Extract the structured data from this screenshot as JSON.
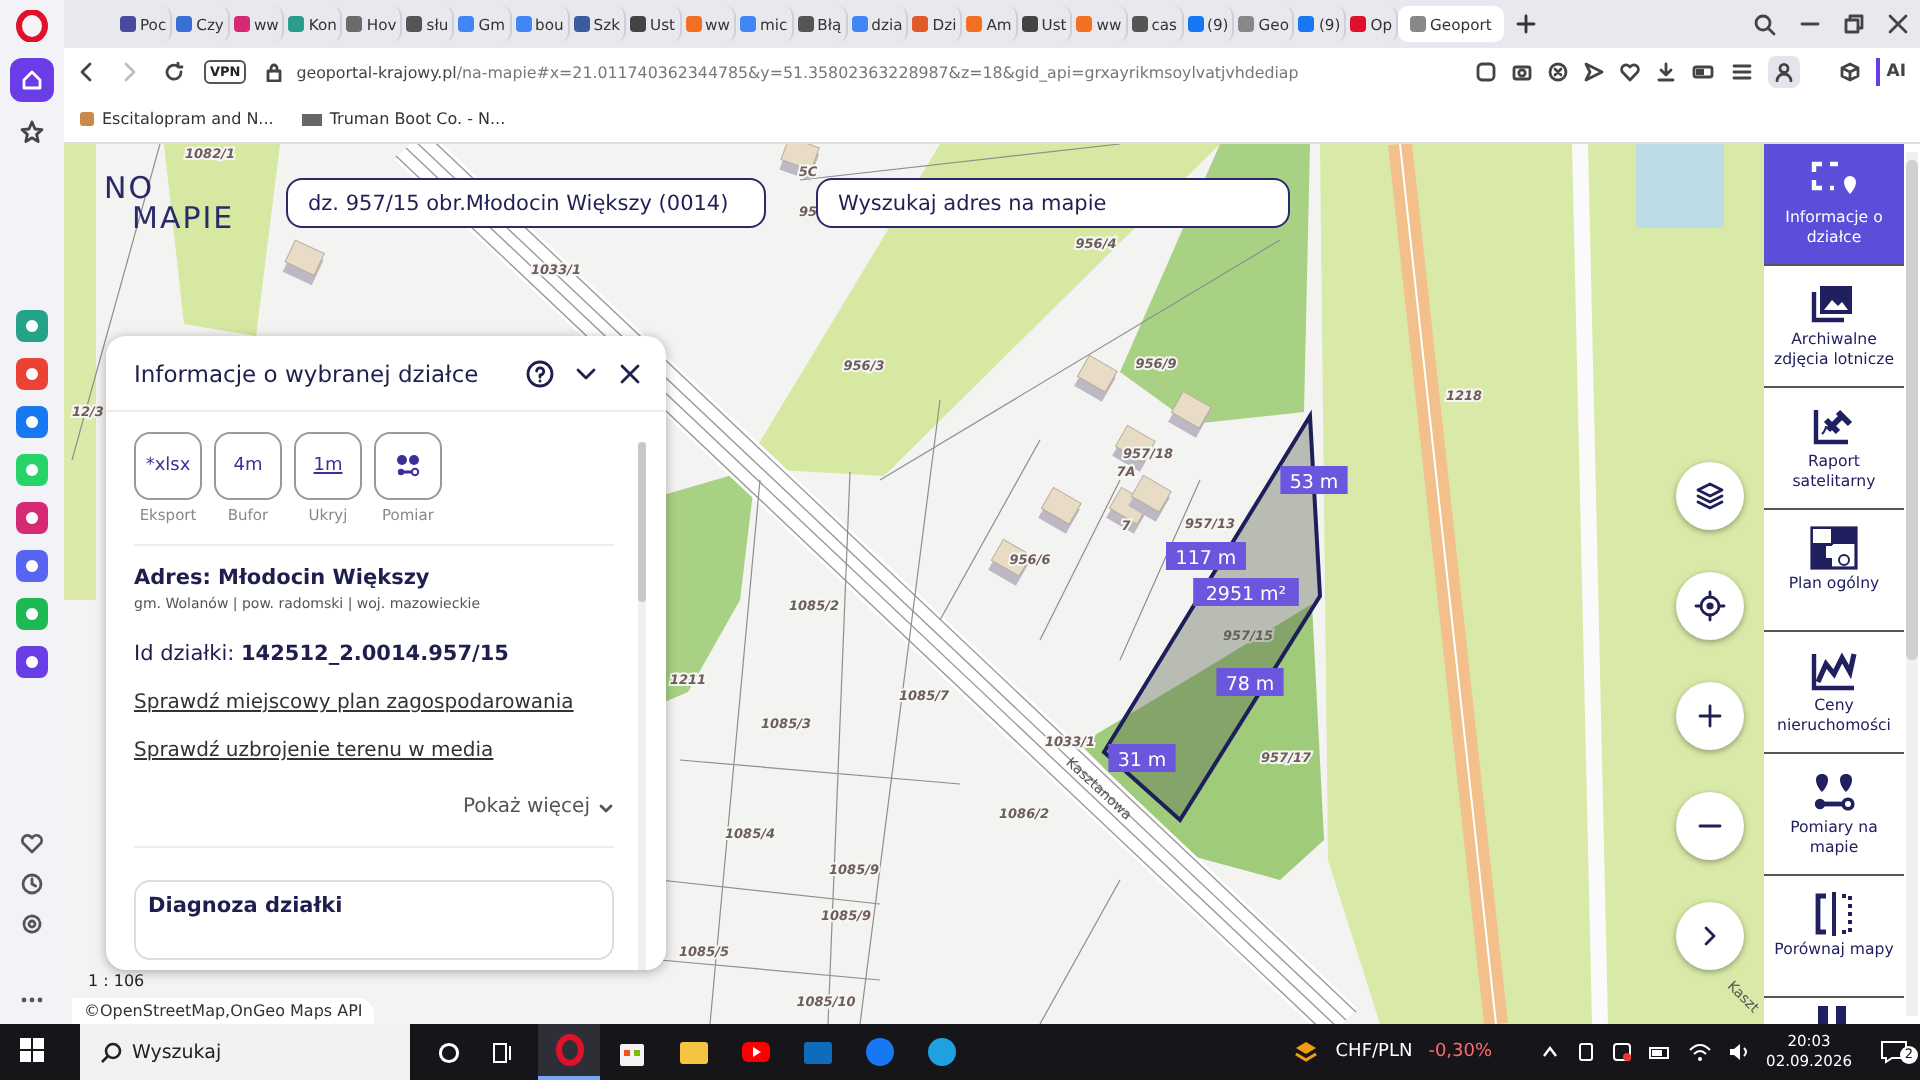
{
  "tabs": [
    {
      "label": "Poc",
      "selected": false,
      "color": "#4a4aa0"
    },
    {
      "label": "Czy",
      "selected": false,
      "color": "#3a6fd8"
    },
    {
      "label": "ww",
      "selected": false,
      "color": "#d62976"
    },
    {
      "label": "Kon",
      "selected": false,
      "color": "#2a9d8f"
    },
    {
      "label": "Hov",
      "selected": false,
      "color": "#6b6b6b"
    },
    {
      "label": "słu",
      "selected": false,
      "color": "#555555"
    },
    {
      "label": "Gm",
      "selected": false,
      "color": "#4285f4"
    },
    {
      "label": "bou",
      "selected": false,
      "color": "#4285f4"
    },
    {
      "label": "Szk",
      "selected": false,
      "color": "#3b5aa0"
    },
    {
      "label": "Ust",
      "selected": false,
      "color": "#444444"
    },
    {
      "label": "ww",
      "selected": false,
      "color": "#f36f21"
    },
    {
      "label": "mic",
      "selected": false,
      "color": "#4285f4"
    },
    {
      "label": "Błą",
      "selected": false,
      "color": "#555555"
    },
    {
      "label": "dzia",
      "selected": false,
      "color": "#4285f4"
    },
    {
      "label": "Dzi",
      "selected": false,
      "color": "#e05a2b"
    },
    {
      "label": "Am",
      "selected": false,
      "color": "#f36f21"
    },
    {
      "label": "Ust",
      "selected": false,
      "color": "#444444"
    },
    {
      "label": "ww",
      "selected": false,
      "color": "#f36f21"
    },
    {
      "label": "cas",
      "selected": false,
      "color": "#555555"
    },
    {
      "label": "(9)",
      "selected": false,
      "color": "#1877f2"
    },
    {
      "label": "Geo",
      "selected": false,
      "color": "#888888"
    },
    {
      "label": "(9)",
      "selected": false,
      "color": "#1877f2"
    },
    {
      "label": "Op",
      "selected": false,
      "color": "#e0112b"
    },
    {
      "label": "Geoport",
      "selected": true,
      "color": "#888888"
    }
  ],
  "address_bar": {
    "vpn": "VPN",
    "url_host": "geoportal-krajowy.pl",
    "url_path": "/na-mapie#x=21.011740362344785&y=51.35802363228987&z=18&gid_api=grxayrikmsoylvatjvhdediap",
    "ai": "AI"
  },
  "bookmarks": [
    "Escitalopram and N...",
    "Truman Boot Co. - N..."
  ],
  "opera_sidebar": {
    "nav": [
      {
        "selected": true
      },
      {
        "selected": false
      }
    ]
  },
  "map": {
    "logo_lines": [
      "NO",
      "MAPIE"
    ],
    "plot_search": "dz. 957/15 obr.Młodocin Większy (0014)",
    "address_search": {
      "placeholder": "Wyszukaj adres na mapie"
    },
    "parcel_numbers": [
      "1082/1",
      "1033/1",
      "5C",
      "95",
      "956/4",
      "956/3",
      "956/9",
      "957/18",
      "7A",
      "7",
      "957/13",
      "956/6",
      "957/15",
      "957/17",
      "1085/2",
      "1211",
      "1085/7",
      "1085/3",
      "1033/1",
      "1086/2",
      "1085/4",
      "1085/9",
      "1085/9",
      "1085/5",
      "1085/10",
      "1218",
      "12/3"
    ],
    "street_names": [
      "Kasztanowa",
      "Kaszt"
    ],
    "measurements": [
      "53 m",
      "117 m",
      "78 m",
      "31 m"
    ],
    "area": "2951 m²",
    "scale": "1 : 106",
    "attribution": "©OpenStreetMap,OnGeo Maps API"
  },
  "info_panel": {
    "title": "Informacje o wybranej działce",
    "actions": [
      {
        "kind": "text",
        "text": "*xlsx",
        "label": "Eksport"
      },
      {
        "kind": "text",
        "text": "4m",
        "label": "Bufor"
      },
      {
        "kind": "ruler",
        "text": "1m",
        "label": "Ukryj"
      },
      {
        "kind": "pins",
        "label": "Pomiar"
      }
    ],
    "address": "Adres: Młodocin Większy",
    "admin": "gm. Wolanów | pow. radomski | woj. mazowieckie",
    "id_label": "Id działki:",
    "id_value": "142512_2.0014.957/15",
    "links": [
      "Sprawdź miejscowy plan zagospodarowania",
      "Sprawdź uzbrojenie terenu w media"
    ],
    "more": "Pokaż więcej",
    "diagnosis": "Diagnoza działki"
  },
  "tools": [
    {
      "label": "Informacje o działce",
      "selected": true
    },
    {
      "label": "Archiwalne zdjęcia lotnicze",
      "selected": false
    },
    {
      "label": "Raport satelitarny",
      "selected": false
    },
    {
      "label": "Plan ogólny",
      "selected": false
    },
    {
      "label": "Ceny nieruchomości",
      "selected": false
    },
    {
      "label": "Pomiary na mapie",
      "selected": false
    },
    {
      "label": "Porównaj mapy",
      "selected": false
    }
  ],
  "taskbar": {
    "search": {
      "placeholder": "Wyszukaj"
    },
    "apps": [
      {
        "selected": true
      },
      {
        "selected": false
      },
      {
        "selected": false
      },
      {
        "selected": false
      },
      {
        "selected": false
      },
      {
        "selected": false
      },
      {
        "selected": false
      }
    ],
    "ticker": "CHF/PLN",
    "change": "-0,30%",
    "time": "20:03",
    "date": "02.09.2026",
    "notifications": "2"
  }
}
